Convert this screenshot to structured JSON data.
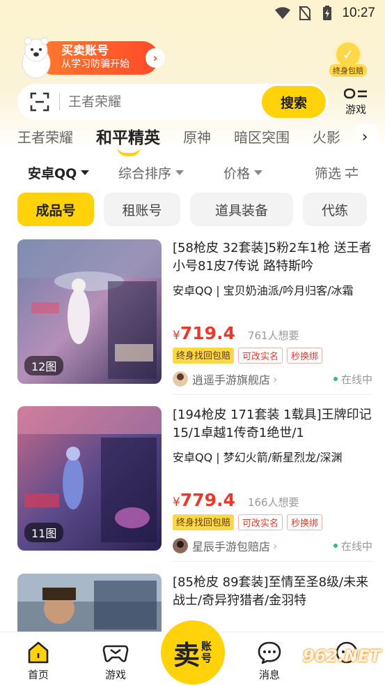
{
  "status_bar": {
    "time": "10:27"
  },
  "promo": {
    "title": "买卖账号",
    "subtitle": "从学习防骗开始",
    "arrow": "›"
  },
  "badge": {
    "label": "终身包赔",
    "icon": "check-shield-icon"
  },
  "search": {
    "placeholder": "王者荣耀",
    "button_label": "搜索",
    "games_label": "游戏"
  },
  "game_tabs": [
    {
      "label": "王者荣耀",
      "active": false
    },
    {
      "label": "和平精英",
      "active": true
    },
    {
      "label": "原神",
      "active": false
    },
    {
      "label": "暗区突围",
      "active": false
    },
    {
      "label": "火影",
      "active": false
    }
  ],
  "filters": [
    {
      "label": "安卓QQ",
      "active": true
    },
    {
      "label": "综合排序",
      "active": false
    },
    {
      "label": "价格",
      "active": false
    },
    {
      "label": "筛选",
      "active": false
    }
  ],
  "chips": [
    {
      "label": "成品号",
      "active": true
    },
    {
      "label": "租账号",
      "active": false
    },
    {
      "label": "道具装备",
      "active": false
    },
    {
      "label": "代练",
      "active": false
    }
  ],
  "listings": [
    {
      "image_count": "12图",
      "title": "[58枪皮 32套装]5粉2车1枪 送王者小号81皮7传说 路特斯吟",
      "attrs": "安卓QQ | 宝贝奶油派/吟月归客/冰霜",
      "price_symbol": "¥",
      "price": "719.4",
      "wants": "761人想要",
      "tags": [
        "终身找回包赔",
        "可改实名",
        "秒换绑"
      ],
      "shop": "逍遥手游旗舰店",
      "status": "在线中"
    },
    {
      "image_count": "11图",
      "title": "[194枪皮 171套装 1载具]王牌印记15/1卓越1传奇1绝世/1",
      "attrs": "安卓QQ | 梦幻火箭/新星烈龙/深渊",
      "price_symbol": "¥",
      "price": "779.4",
      "wants": "166人想要",
      "tags": [
        "终身找回包赔",
        "可改实名",
        "秒换绑"
      ],
      "shop": "星辰手游包赔店",
      "status": "在线中"
    },
    {
      "image_count": "",
      "title": "[85枪皮 89套装]至情至圣8级/未来战士/奇异狩猎者/金羽特",
      "attrs": "",
      "price_symbol": "",
      "price": "",
      "wants": "",
      "tags": [],
      "shop": "",
      "status": ""
    }
  ],
  "bottom_nav": {
    "home": "首页",
    "games": "游戏",
    "sell_big": "卖",
    "sell_small": "账号",
    "messages": "消息"
  },
  "watermark": "962.NET",
  "colors": {
    "accent": "#ffd20a",
    "price": "#e8392b",
    "promo": "#ff5a2a"
  }
}
